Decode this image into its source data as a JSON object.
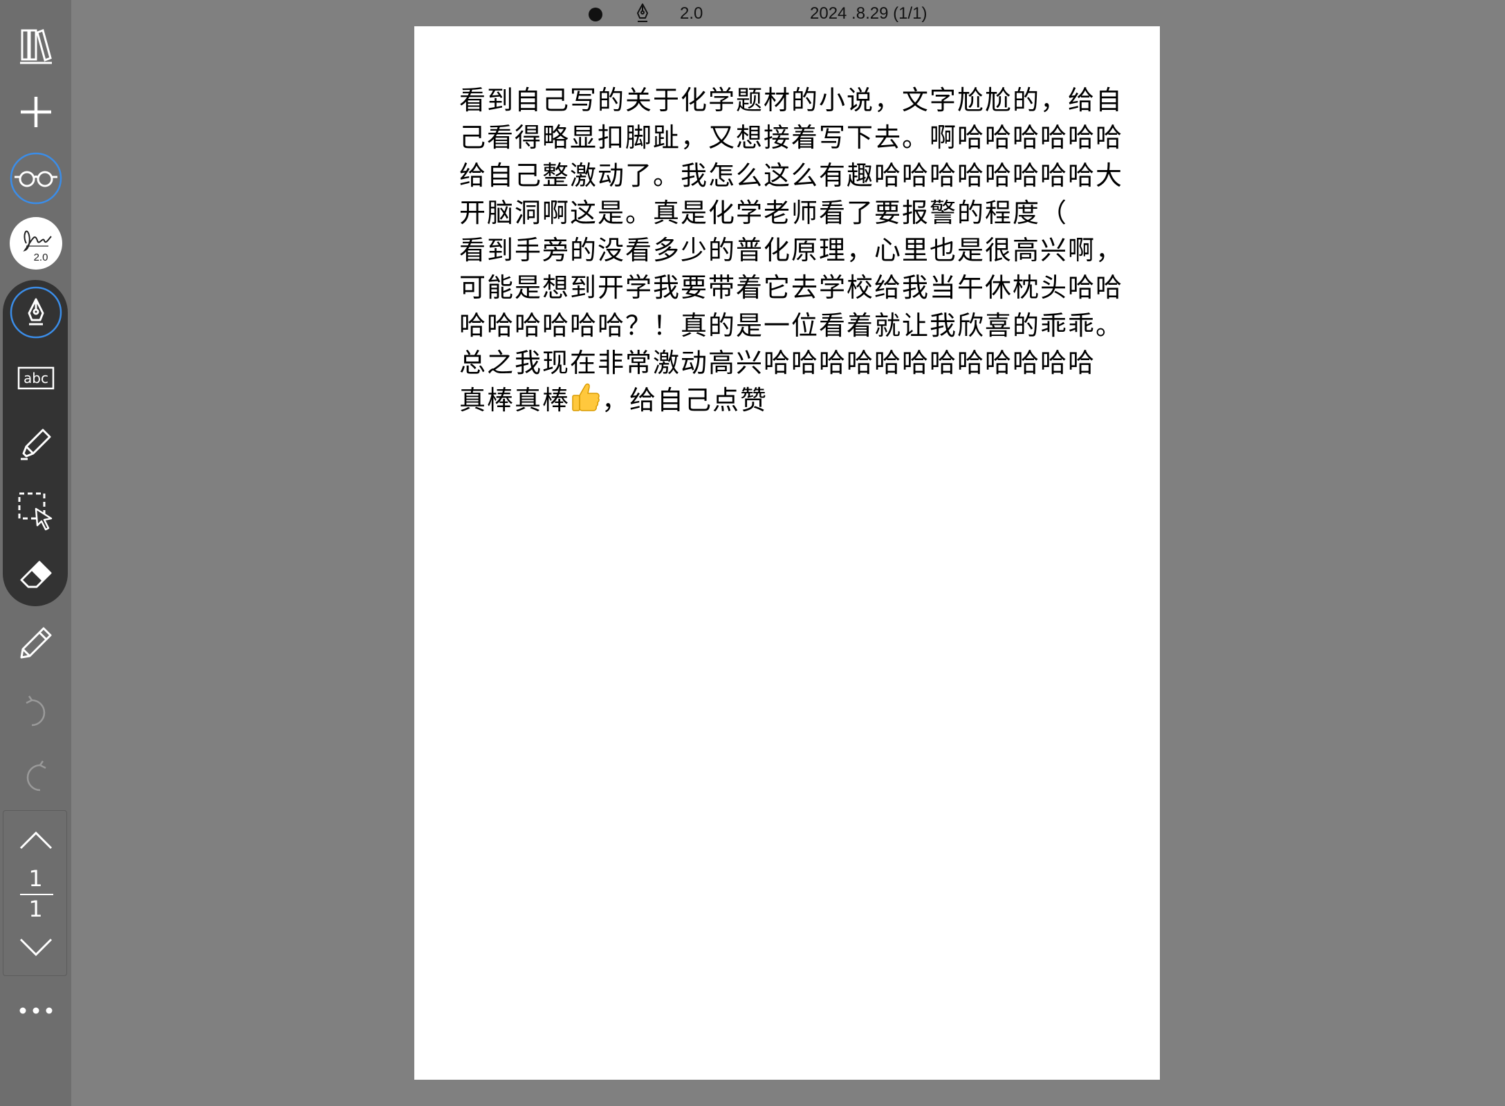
{
  "status_bar": {
    "pen_size": "2.0",
    "date_page": "2024 .8.29 (1/1)"
  },
  "toolbar": {
    "signature_size": "2.0",
    "page_current": "1",
    "page_total": "1",
    "accent_color": "#3b8de8"
  },
  "document": {
    "paragraphs": [
      "看到自己写的关于化学题材的小说，文字尬尬的，给自己看得略显扣脚趾，又想接着写下去。啊哈哈哈哈哈哈给自己整激动了。我怎么这么有趣哈哈哈哈哈哈哈哈大开脑洞啊这是。真是化学老师看了要报警的程度（",
      "看到手旁的没看多少的普化原理，心里也是很高兴啊，可能是想到开学我要带着它去学校给我当午休枕头哈哈哈哈哈哈哈哈？！真的是一位看着就让我欣喜的乖乖。",
      "总之我现在非常激动高兴哈哈哈哈哈哈哈哈哈哈哈哈"
    ],
    "last_line_before_emoji": "真棒真棒",
    "last_line_after_emoji": "，给自己点赞"
  }
}
